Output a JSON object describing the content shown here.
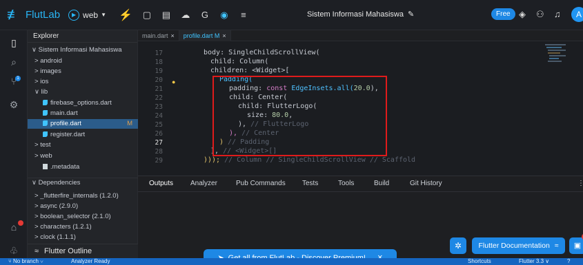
{
  "app": {
    "name": "FlutLab",
    "run_target": "web",
    "project_title": "Sistem Informasi Mahasiswa",
    "plan_badge": "Free",
    "avatar_letter": "A"
  },
  "explorer": {
    "title": "Explorer",
    "items": [
      {
        "label": "Sistem Informasi Mahasiswa",
        "prefix": "∨"
      },
      {
        "label": "android",
        "prefix": ">"
      },
      {
        "label": "images",
        "prefix": ">"
      },
      {
        "label": "ios",
        "prefix": ">"
      },
      {
        "label": "lib",
        "prefix": "∨"
      },
      {
        "label": "firebase_options.dart"
      },
      {
        "label": "main.dart"
      },
      {
        "label": "profile.dart",
        "modified": "M"
      },
      {
        "label": "register.dart"
      },
      {
        "label": "test",
        "prefix": ">"
      },
      {
        "label": "web",
        "prefix": ">"
      },
      {
        "label": ".metadata"
      }
    ],
    "dependencies_title": "Dependencies",
    "dependencies": [
      "_flutterfire_internals (1.2.0)",
      "async (2.9.0)",
      "boolean_selector (2.1.0)",
      "characters (1.2.1)",
      "clock (1.1.1)"
    ],
    "outline_label": "Flutter Outline"
  },
  "tabs": [
    {
      "label": "main.dart"
    },
    {
      "label": "profile.dart M"
    }
  ],
  "editor": {
    "line_numbers": [
      "17",
      "18",
      "19",
      "20",
      "21",
      "22",
      "23",
      "24",
      "25",
      "26",
      "27",
      "28",
      "29"
    ],
    "current_line": "27",
    "lines": {
      "l17": "body: SingleChildScrollView(",
      "l18": "child: Column(",
      "l19": "children: <Widget>[",
      "l20": "Padding(",
      "l21a": "padding: ",
      "l21b": "const ",
      "l21c": "EdgeInsets.all(",
      "l21d": "20.0",
      "l21e": "),",
      "l22": "child: Center(",
      "l23": "child: FlutterLogo(",
      "l24a": "size: ",
      "l24b": "80.0",
      "l24c": ",",
      "l25a": "), ",
      "l25b": "// FlutterLogo",
      "l26a": "), ",
      "l26b": "// Center",
      "l27a": ") ",
      "l27b": "// Padding",
      "l28a": "], ",
      "l28b": "// <Widget>[]",
      "l29a": "))); ",
      "l29b": "// Column // SingleChildScrollView // Scaffold"
    }
  },
  "panel": {
    "tabs": [
      "Outputs",
      "Analyzer",
      "Pub Commands",
      "Tests",
      "Tools",
      "Build",
      "Git History"
    ]
  },
  "floating": {
    "premium": "Get all from FlutLab - Discover Premium!",
    "docs": "Flutter Documentation",
    "chat_badge": "0"
  },
  "status": {
    "branch": "No branch",
    "analyzer": "Analyzer Ready",
    "shortcuts": "Shortcuts",
    "flutter_version": "Flutter 3.3"
  },
  "colors": {
    "accent": "#1e88e5",
    "brand": "#29b6f6",
    "highlight_box": "#e01b1b"
  }
}
